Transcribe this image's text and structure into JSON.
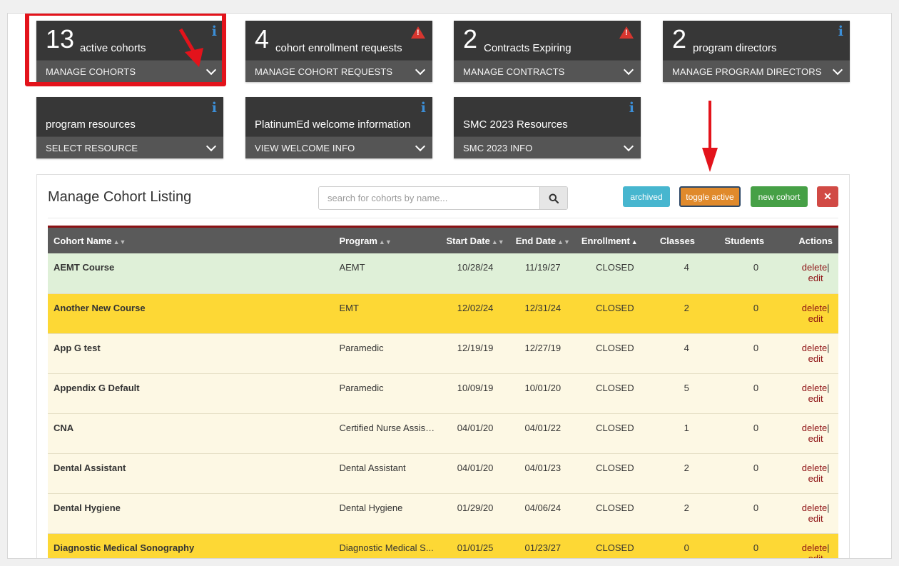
{
  "cards": [
    {
      "count": "13",
      "label": "active cohorts",
      "action": "MANAGE COHORTS",
      "icon": "info-icon"
    },
    {
      "count": "4",
      "label": "cohort enrollment requests",
      "action": "MANAGE COHORT REQUESTS",
      "icon": "warning-icon"
    },
    {
      "count": "2",
      "label": "Contracts Expiring",
      "action": "MANAGE CONTRACTS",
      "icon": "warning-icon"
    },
    {
      "count": "2",
      "label": "program directors",
      "action": "MANAGE PROGRAM DIRECTORS",
      "icon": "info-icon"
    },
    {
      "count": "",
      "label": "program resources",
      "action": "SELECT RESOURCE",
      "icon": "info-icon"
    },
    {
      "count": "",
      "label": "PlatinumEd welcome information",
      "action": "VIEW WELCOME INFO",
      "icon": "info-icon"
    },
    {
      "count": "",
      "label": "SMC 2023 Resources",
      "action": "SMC 2023 INFO",
      "icon": "info-icon"
    }
  ],
  "panel": {
    "title": "Manage Cohort Listing",
    "search_placeholder": "search for cohorts by name...",
    "buttons": {
      "archived": "archived",
      "toggle": "toggle active",
      "new": "new cohort",
      "close": "✕"
    }
  },
  "table": {
    "headers": {
      "name": "Cohort Name",
      "program": "Program",
      "start": "Start Date",
      "end": "End Date",
      "enrollment": "Enrollment",
      "classes": "Classes",
      "students": "Students",
      "actions": "Actions"
    },
    "action_delete": "delete",
    "action_sep": "|",
    "action_edit": "edit",
    "rows": [
      {
        "name": "AEMT Course",
        "program": "AEMT",
        "start": "10/28/24",
        "end": "11/19/27",
        "enrollment": "CLOSED",
        "classes": "4",
        "students": "0"
      },
      {
        "name": "Another New Course",
        "program": "EMT",
        "start": "12/02/24",
        "end": "12/31/24",
        "enrollment": "CLOSED",
        "classes": "2",
        "students": "0"
      },
      {
        "name": "App G test",
        "program": "Paramedic",
        "start": "12/19/19",
        "end": "12/27/19",
        "enrollment": "CLOSED",
        "classes": "4",
        "students": "0"
      },
      {
        "name": "Appendix G Default",
        "program": "Paramedic",
        "start": "10/09/19",
        "end": "10/01/20",
        "enrollment": "CLOSED",
        "classes": "5",
        "students": "0"
      },
      {
        "name": "CNA",
        "program": "Certified Nurse Assist...",
        "start": "04/01/20",
        "end": "04/01/22",
        "enrollment": "CLOSED",
        "classes": "1",
        "students": "0"
      },
      {
        "name": "Dental Assistant",
        "program": "Dental Assistant",
        "start": "04/01/20",
        "end": "04/01/23",
        "enrollment": "CLOSED",
        "classes": "2",
        "students": "0"
      },
      {
        "name": "Dental Hygiene",
        "program": "Dental Hygiene",
        "start": "01/29/20",
        "end": "04/06/24",
        "enrollment": "CLOSED",
        "classes": "2",
        "students": "0"
      },
      {
        "name": "Diagnostic Medical Sonography",
        "program": "Diagnostic Medical S...",
        "start": "01/01/25",
        "end": "01/23/27",
        "enrollment": "CLOSED",
        "classes": "0",
        "students": "0"
      }
    ]
  },
  "colors": {
    "row_green": "#dff0d8",
    "row_yellow": "#fdd835",
    "row_cream": "#fdf8e4",
    "annotation_red": "#e3131b"
  }
}
